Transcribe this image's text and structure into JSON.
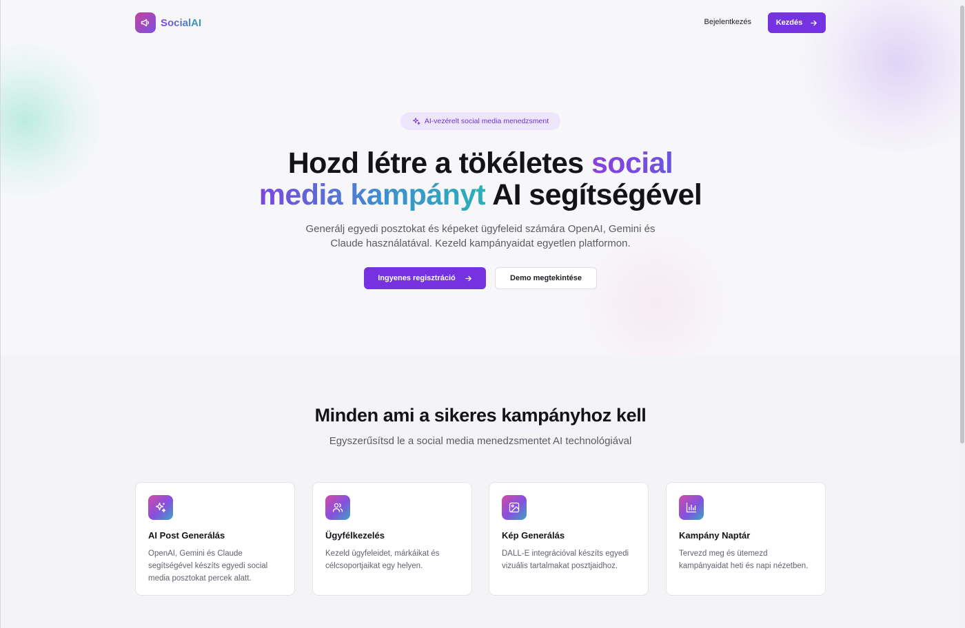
{
  "header": {
    "brand": "SocialAI",
    "login_label": "Bejelentkezés",
    "start_label": "Kezdés"
  },
  "hero": {
    "badge": "AI-vezérelt social media menedzsment",
    "title_part1": "Hozd létre a tökéletes ",
    "title_highlight1": "social",
    "title_highlight2": "media kampányt",
    "title_part2": " AI segítségével",
    "subtitle": "Generálj egyedi posztokat és képeket ügyfeleid számára OpenAI, Gemini és Claude használatával. Kezeld kampányaidat egyetlen platformon.",
    "primary_cta": "Ingyenes regisztráció",
    "secondary_cta": "Demo megtekintése"
  },
  "features": {
    "title": "Minden ami a sikeres kampányhoz kell",
    "subtitle": "Egyszerűsítsd le a social media menedzsmentet AI technológiával",
    "cards": [
      {
        "icon": "sparkles-icon",
        "title": "AI Post Generálás",
        "description": "OpenAI, Gemini és Claude segítségével készíts egyedi social media posztokat percek alatt."
      },
      {
        "icon": "users-icon",
        "title": "Ügyfélkezelés",
        "description": "Kezeld ügyfeleidet, márkáikat és célcsoportjaikat egy helyen."
      },
      {
        "icon": "image-icon",
        "title": "Kép Generálás",
        "description": "DALL-E integrációval készíts egyedi vizuális tartalmakat posztjaidhoz."
      },
      {
        "icon": "bar-chart-icon",
        "title": "Kampány Naptár",
        "description": "Tervezd meg és ütemezd kampányaidat heti és napi nézetben."
      }
    ]
  },
  "colors": {
    "accent": "#7432e0",
    "gradient_start": "#7b47df",
    "gradient_end": "#2bb0b6"
  }
}
